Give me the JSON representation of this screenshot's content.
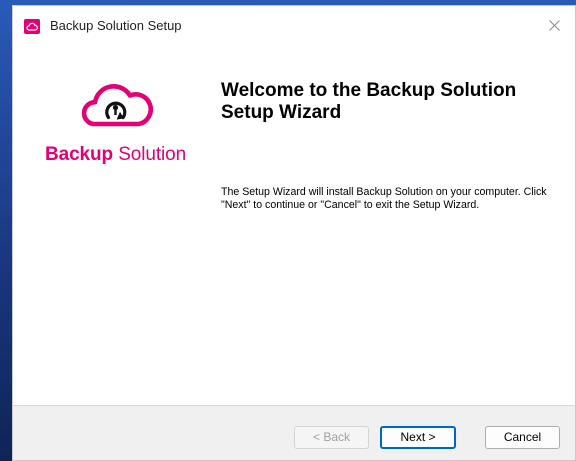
{
  "window": {
    "title": "Backup Solution Setup"
  },
  "brand": {
    "bold_word": "Backup",
    "light_word": "Solution",
    "color": "#e20074"
  },
  "content": {
    "headline": "Welcome to the Backup Solution Setup Wizard",
    "description": "The Setup Wizard will install Backup Solution on your computer.  Click \"Next\" to continue or \"Cancel\" to exit the Setup Wizard."
  },
  "buttons": {
    "back_label": "< Back",
    "next_label": "Next >",
    "cancel_label": "Cancel"
  },
  "icons": {
    "app": "cloud-backup-icon",
    "close": "close-icon",
    "logo": "cloud-restore-icon"
  },
  "colors": {
    "accent": "#e20074",
    "default_button_border": "#0067c0"
  }
}
